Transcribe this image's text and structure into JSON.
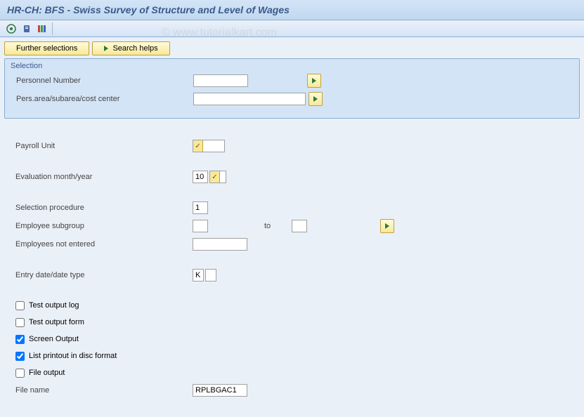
{
  "title": "HR-CH: BFS - Swiss Survey of Structure and Level of Wages",
  "watermark": "© www.tutorialkart.com",
  "toolbar": {
    "further_selections": "Further selections",
    "search_helps": "Search helps"
  },
  "selection": {
    "group_title": "Selection",
    "personnel_number_label": "Personnel Number",
    "personnel_number_value": "",
    "pers_area_label": "Pers.area/subarea/cost center",
    "pers_area_value": ""
  },
  "form": {
    "payroll_unit_label": "Payroll Unit",
    "payroll_unit_value": "",
    "eval_month_label": "Evaluation month/year",
    "eval_month_value": "10",
    "eval_year_value": "",
    "sel_proc_label": "Selection procedure",
    "sel_proc_value": "1",
    "emp_subgroup_label": "Employee subgroup",
    "emp_subgroup_from": "",
    "to_label": "to",
    "emp_subgroup_to": "",
    "emp_not_entered_label": "Employees not entered",
    "emp_not_entered_value": "",
    "entry_date_label": "Entry date/date type",
    "entry_date_value1": "K",
    "entry_date_value2": "",
    "cb_test_output_log": "Test output log",
    "cb_test_output_form": "Test output form",
    "cb_screen_output": "Screen Output",
    "cb_list_printout": "List printout in disc format",
    "cb_file_output": "File output",
    "file_name_label": "File name",
    "file_name_value": "RPLBGAC1"
  },
  "checkbox_state": {
    "test_output_log": false,
    "test_output_form": false,
    "screen_output": true,
    "list_printout": true,
    "file_output": false
  }
}
